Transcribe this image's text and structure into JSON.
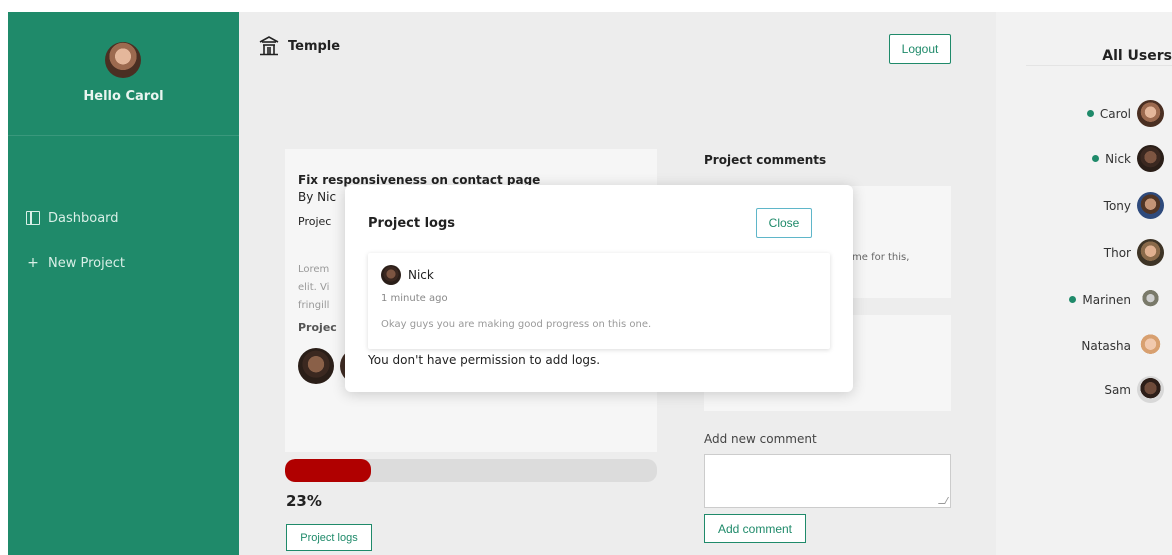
{
  "colors": {
    "brand": "#1f8a6a",
    "progress": "#b00000",
    "online": "#1f8a6a"
  },
  "sidebar": {
    "greeting": "Hello Carol",
    "items": [
      {
        "label": "Dashboard",
        "icon": "dashboard-icon"
      },
      {
        "label": "New Project",
        "icon": "plus-icon"
      }
    ]
  },
  "header": {
    "brand": "Temple",
    "brand_icon": "temple-icon",
    "logout_label": "Logout"
  },
  "project": {
    "title": "Fix responsiveness on contact page",
    "by": "By Nic",
    "proj_label": "Projec",
    "description_lines": [
      "Lorem",
      "elit. Vi",
      "fringill"
    ],
    "team_label": "Projec",
    "progress_percent": 23,
    "progress_text": "23%",
    "logs_button": "Project logs"
  },
  "comments": {
    "title": "Project comments",
    "comment1_text": "me for this,",
    "comment2_text": "",
    "add_label": "Add new comment",
    "add_button": "Add comment"
  },
  "users_panel": {
    "title": "All Users",
    "users": [
      {
        "name": "Carol",
        "online": true
      },
      {
        "name": "Nick",
        "online": true
      },
      {
        "name": "Tony",
        "online": false
      },
      {
        "name": "Thor",
        "online": false
      },
      {
        "name": "Marinen",
        "online": true
      },
      {
        "name": "Natasha",
        "online": false
      },
      {
        "name": "Sam",
        "online": false
      }
    ]
  },
  "modal": {
    "title": "Project logs",
    "close_label": "Close",
    "log": {
      "author": "Nick",
      "time": "1 minute ago",
      "text": "Okay guys you are making good progress on this one."
    },
    "note": "You don't have permission to add logs."
  }
}
